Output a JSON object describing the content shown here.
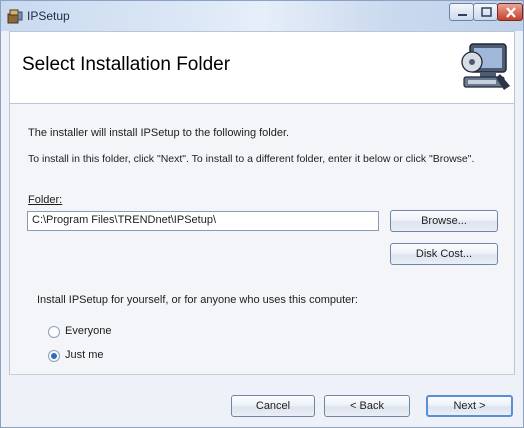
{
  "window": {
    "title": "IPSetup",
    "colors": {
      "title_gradient": "#c9d9ef",
      "close_button": "#c4412a",
      "accent": "#2e6cbd"
    }
  },
  "header": {
    "title": "Select Installation Folder",
    "graphic": "computer-disc-icon"
  },
  "body": {
    "intro": "The installer will install IPSetup to the following folder.",
    "instructions": "To install in this folder, click \"Next\". To install to a different folder, enter it below or click \"Browse\".",
    "folder_label": "Folder:",
    "folder_value": "C:\\Program Files\\TRENDnet\\IPSetup\\",
    "browse_label": "Browse...",
    "disk_cost_label": "Disk Cost...",
    "install_for_question": "Install IPSetup for yourself, or for anyone who uses this computer:",
    "options": [
      {
        "label": "Everyone",
        "selected": false
      },
      {
        "label": "Just me",
        "selected": true
      }
    ]
  },
  "footer": {
    "cancel_label": "Cancel",
    "back_label": "< Back",
    "next_label": "Next >"
  }
}
